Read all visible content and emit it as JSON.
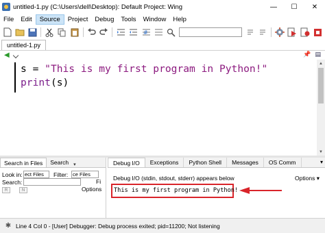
{
  "window": {
    "title": "untitled-1.py (C:\\Users\\dell\\Desktop): Default Project: Wing",
    "minimize_glyph": "—",
    "maximize_glyph": "☐",
    "close_glyph": "✕"
  },
  "menubar": {
    "items": [
      "File",
      "Edit",
      "Source",
      "Project",
      "Debug",
      "Tools",
      "Window",
      "Help"
    ],
    "active": "Source"
  },
  "toolbar": {
    "icons": [
      "new-file-icon",
      "open-folder-icon",
      "save-icon",
      "cut-icon",
      "copy-icon",
      "paste-icon",
      "undo-icon",
      "redo-icon",
      "indent-icon",
      "outdent-icon",
      "comment-icon",
      "uncomment-icon",
      "search-icon",
      "search-box",
      "find-next-icon",
      "find-prev-icon",
      "settings-icon",
      "debug-run-icon",
      "record-icon",
      "stop-icon"
    ],
    "search_value": ""
  },
  "editor": {
    "tab_label": "untitled-1.py",
    "lines": [
      {
        "var": "s = ",
        "string": "\"This is my first program in Python!\""
      },
      {
        "keyword": "print",
        "rest": "(s)"
      }
    ]
  },
  "left_panel": {
    "tabs": [
      "Search in Files",
      "Search"
    ],
    "active_tab": "Search in Files",
    "look_in_label": "Look in:",
    "look_in_value": "ect Files",
    "filter_label": "Filter:",
    "filter_value": "ce Files",
    "search_label": "Search:",
    "search_value": "",
    "options_label": "Options",
    "button_label": "Fi",
    "toggle_labels": [
      "R",
      "N"
    ]
  },
  "right_panel": {
    "tabs": [
      "Debug I/O",
      "Exceptions",
      "Python Shell",
      "Messages",
      "OS Comm"
    ],
    "active_tab": "Debug I/O",
    "header": "Debug I/O (stdin, stdout, stderr) appears below",
    "options_label": "Options",
    "output": "This is my first program in Python!",
    "annotation_color": "#d9242a"
  },
  "statusbar": {
    "text": "Line 4 Col 0 - [User] Debugger: Debug process exited; pid=11200; Not listening"
  }
}
